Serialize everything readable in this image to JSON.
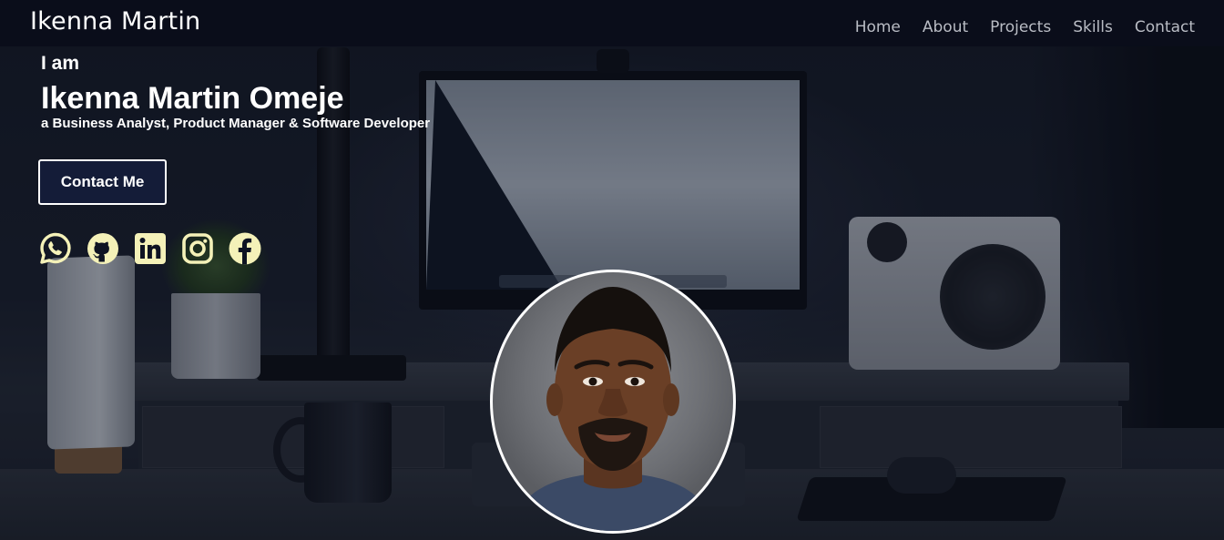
{
  "nav": {
    "brand": "Ikenna Martin",
    "links": [
      "Home",
      "About",
      "Projects",
      "Skills",
      "Contact"
    ]
  },
  "hero": {
    "intro": "I am",
    "name": "Ikenna Martin Omeje",
    "roles": "a Business Analyst, Product Manager & Software Developer",
    "cta_label": "Contact Me"
  },
  "socials": [
    {
      "name": "whatsapp-icon"
    },
    {
      "name": "github-icon"
    },
    {
      "name": "linkedin-icon"
    },
    {
      "name": "instagram-icon"
    },
    {
      "name": "facebook-icon"
    }
  ],
  "colors": {
    "icon_accent": "#f4f1b8",
    "button_bg": "#141c38",
    "nav_link": "#b9bcc4",
    "navbar_bg": "#0a0d1a"
  }
}
